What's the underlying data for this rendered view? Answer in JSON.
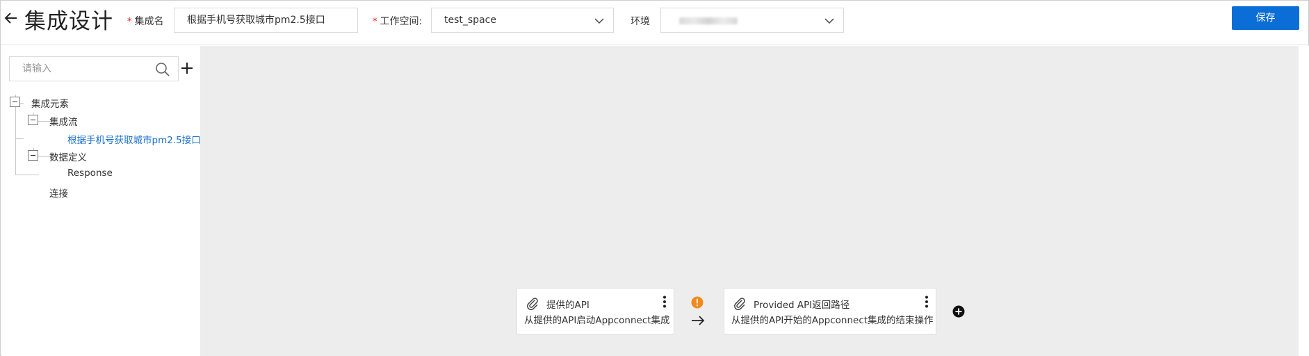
{
  "header": {
    "title": "集成设计",
    "name_label": "集成名",
    "name_value": "根据手机号获取城市pm2.5接口",
    "workspace_label": "工作空间:",
    "workspace_value": "test_space",
    "env_label": "环境",
    "save_label": "保存"
  },
  "sidebar": {
    "search_placeholder": "请输入",
    "tree": {
      "root": "集成元素",
      "flow_group": "集成流",
      "flow_item": "根据手机号获取城市pm2.5接口",
      "data_group": "数据定义",
      "data_item": "Response",
      "connection": "连接"
    }
  },
  "canvas": {
    "nodes": [
      {
        "title": "提供的API",
        "description": "从提供的API启动Appconnect集成"
      },
      {
        "title": "Provided API返回路径",
        "description": "从提供的API开始的Appconnect集成的结束操作"
      }
    ]
  },
  "colors": {
    "primary": "#0a6ed6",
    "warning": "#f08a1c",
    "link": "#1a6fc8",
    "canvas_bg": "#ededed"
  },
  "icons": [
    "back-arrow-icon",
    "chevron-down-icon",
    "search-icon",
    "plus-icon",
    "paperclip-icon",
    "more-vertical-icon",
    "warning-icon",
    "arrow-right-icon",
    "plus-circle-icon"
  ]
}
